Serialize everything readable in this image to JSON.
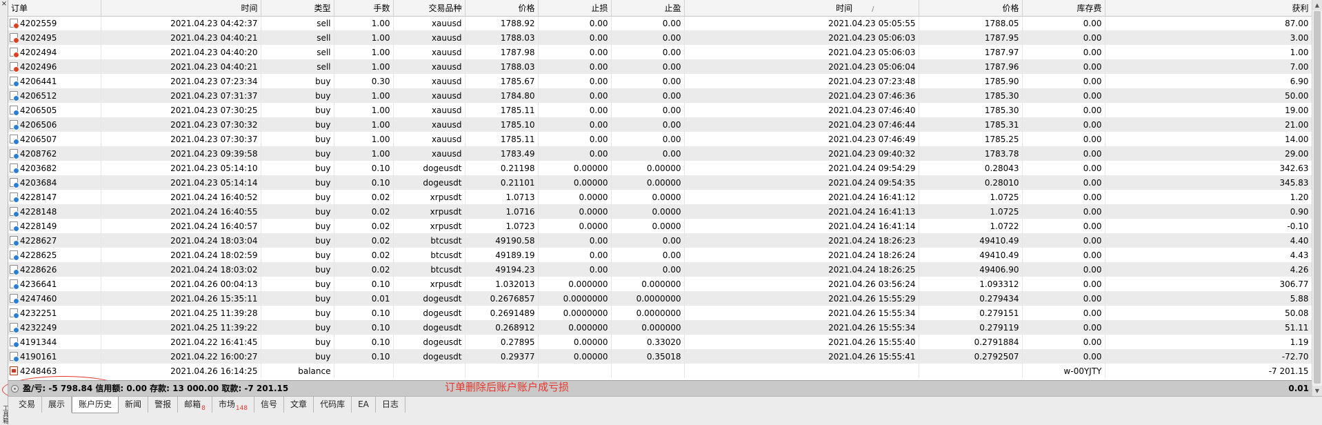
{
  "columns": [
    "订单",
    "时间",
    "类型",
    "手数",
    "交易品种",
    "价格",
    "止损",
    "止盈",
    "时间",
    "价格",
    "库存费",
    "获利"
  ],
  "sort_indicator": "/",
  "rows": [
    {
      "ticket": "4202559",
      "open_time": "2021.04.23 04:42:37",
      "type": "sell",
      "volume": "1.00",
      "symbol": "xauusd",
      "open_price": "1788.92",
      "sl": "0.00",
      "tp": "0.00",
      "close_time": "2021.04.23 05:05:55",
      "close_price": "1788.05",
      "swap": "0.00",
      "profit": "87.00",
      "icon": "sell"
    },
    {
      "ticket": "4202495",
      "open_time": "2021.04.23 04:40:21",
      "type": "sell",
      "volume": "1.00",
      "symbol": "xauusd",
      "open_price": "1788.03",
      "sl": "0.00",
      "tp": "0.00",
      "close_time": "2021.04.23 05:06:03",
      "close_price": "1787.95",
      "swap": "0.00",
      "profit": "3.00",
      "icon": "sell"
    },
    {
      "ticket": "4202494",
      "open_time": "2021.04.23 04:40:20",
      "type": "sell",
      "volume": "1.00",
      "symbol": "xauusd",
      "open_price": "1787.98",
      "sl": "0.00",
      "tp": "0.00",
      "close_time": "2021.04.23 05:06:03",
      "close_price": "1787.97",
      "swap": "0.00",
      "profit": "1.00",
      "icon": "sell"
    },
    {
      "ticket": "4202496",
      "open_time": "2021.04.23 04:40:21",
      "type": "sell",
      "volume": "1.00",
      "symbol": "xauusd",
      "open_price": "1788.03",
      "sl": "0.00",
      "tp": "0.00",
      "close_time": "2021.04.23 05:06:04",
      "close_price": "1787.96",
      "swap": "0.00",
      "profit": "7.00",
      "icon": "sell"
    },
    {
      "ticket": "4206441",
      "open_time": "2021.04.23 07:23:34",
      "type": "buy",
      "volume": "0.30",
      "symbol": "xauusd",
      "open_price": "1785.67",
      "sl": "0.00",
      "tp": "0.00",
      "close_time": "2021.04.23 07:23:48",
      "close_price": "1785.90",
      "swap": "0.00",
      "profit": "6.90",
      "icon": "buy"
    },
    {
      "ticket": "4206512",
      "open_time": "2021.04.23 07:31:37",
      "type": "buy",
      "volume": "1.00",
      "symbol": "xauusd",
      "open_price": "1784.80",
      "sl": "0.00",
      "tp": "0.00",
      "close_time": "2021.04.23 07:46:36",
      "close_price": "1785.30",
      "swap": "0.00",
      "profit": "50.00",
      "icon": "buy"
    },
    {
      "ticket": "4206505",
      "open_time": "2021.04.23 07:30:25",
      "type": "buy",
      "volume": "1.00",
      "symbol": "xauusd",
      "open_price": "1785.11",
      "sl": "0.00",
      "tp": "0.00",
      "close_time": "2021.04.23 07:46:40",
      "close_price": "1785.30",
      "swap": "0.00",
      "profit": "19.00",
      "icon": "buy"
    },
    {
      "ticket": "4206506",
      "open_time": "2021.04.23 07:30:32",
      "type": "buy",
      "volume": "1.00",
      "symbol": "xauusd",
      "open_price": "1785.10",
      "sl": "0.00",
      "tp": "0.00",
      "close_time": "2021.04.23 07:46:44",
      "close_price": "1785.31",
      "swap": "0.00",
      "profit": "21.00",
      "icon": "buy"
    },
    {
      "ticket": "4206507",
      "open_time": "2021.04.23 07:30:37",
      "type": "buy",
      "volume": "1.00",
      "symbol": "xauusd",
      "open_price": "1785.11",
      "sl": "0.00",
      "tp": "0.00",
      "close_time": "2021.04.23 07:46:49",
      "close_price": "1785.25",
      "swap": "0.00",
      "profit": "14.00",
      "icon": "buy"
    },
    {
      "ticket": "4208762",
      "open_time": "2021.04.23 09:39:58",
      "type": "buy",
      "volume": "1.00",
      "symbol": "xauusd",
      "open_price": "1783.49",
      "sl": "0.00",
      "tp": "0.00",
      "close_time": "2021.04.23 09:40:32",
      "close_price": "1783.78",
      "swap": "0.00",
      "profit": "29.00",
      "icon": "buy"
    },
    {
      "ticket": "4203682",
      "open_time": "2021.04.23 05:14:10",
      "type": "buy",
      "volume": "0.10",
      "symbol": "dogeusdt",
      "open_price": "0.21198",
      "sl": "0.00000",
      "tp": "0.00000",
      "close_time": "2021.04.24 09:54:29",
      "close_price": "0.28043",
      "swap": "0.00",
      "profit": "342.63",
      "icon": "buy"
    },
    {
      "ticket": "4203684",
      "open_time": "2021.04.23 05:14:14",
      "type": "buy",
      "volume": "0.10",
      "symbol": "dogeusdt",
      "open_price": "0.21101",
      "sl": "0.00000",
      "tp": "0.00000",
      "close_time": "2021.04.24 09:54:35",
      "close_price": "0.28010",
      "swap": "0.00",
      "profit": "345.83",
      "icon": "buy"
    },
    {
      "ticket": "4228147",
      "open_time": "2021.04.24 16:40:52",
      "type": "buy",
      "volume": "0.02",
      "symbol": "xrpusdt",
      "open_price": "1.0713",
      "sl": "0.0000",
      "tp": "0.0000",
      "close_time": "2021.04.24 16:41:12",
      "close_price": "1.0725",
      "swap": "0.00",
      "profit": "1.20",
      "icon": "buy"
    },
    {
      "ticket": "4228148",
      "open_time": "2021.04.24 16:40:55",
      "type": "buy",
      "volume": "0.02",
      "symbol": "xrpusdt",
      "open_price": "1.0716",
      "sl": "0.0000",
      "tp": "0.0000",
      "close_time": "2021.04.24 16:41:13",
      "close_price": "1.0725",
      "swap": "0.00",
      "profit": "0.90",
      "icon": "buy"
    },
    {
      "ticket": "4228149",
      "open_time": "2021.04.24 16:40:57",
      "type": "buy",
      "volume": "0.02",
      "symbol": "xrpusdt",
      "open_price": "1.0723",
      "sl": "0.0000",
      "tp": "0.0000",
      "close_time": "2021.04.24 16:41:14",
      "close_price": "1.0722",
      "swap": "0.00",
      "profit": "-0.10",
      "icon": "buy"
    },
    {
      "ticket": "4228627",
      "open_time": "2021.04.24 18:03:04",
      "type": "buy",
      "volume": "0.02",
      "symbol": "btcusdt",
      "open_price": "49190.58",
      "sl": "0.00",
      "tp": "0.00",
      "close_time": "2021.04.24 18:26:23",
      "close_price": "49410.49",
      "swap": "0.00",
      "profit": "4.40",
      "icon": "buy"
    },
    {
      "ticket": "4228625",
      "open_time": "2021.04.24 18:02:59",
      "type": "buy",
      "volume": "0.02",
      "symbol": "btcusdt",
      "open_price": "49189.19",
      "sl": "0.00",
      "tp": "0.00",
      "close_time": "2021.04.24 18:26:24",
      "close_price": "49410.49",
      "swap": "0.00",
      "profit": "4.43",
      "icon": "buy"
    },
    {
      "ticket": "4228626",
      "open_time": "2021.04.24 18:03:02",
      "type": "buy",
      "volume": "0.02",
      "symbol": "btcusdt",
      "open_price": "49194.23",
      "sl": "0.00",
      "tp": "0.00",
      "close_time": "2021.04.24 18:26:25",
      "close_price": "49406.90",
      "swap": "0.00",
      "profit": "4.26",
      "icon": "buy"
    },
    {
      "ticket": "4236641",
      "open_time": "2021.04.26 00:04:13",
      "type": "buy",
      "volume": "0.10",
      "symbol": "xrpusdt",
      "open_price": "1.032013",
      "sl": "0.000000",
      "tp": "0.000000",
      "close_time": "2021.04.26 03:56:24",
      "close_price": "1.093312",
      "swap": "0.00",
      "profit": "306.77",
      "icon": "buy"
    },
    {
      "ticket": "4247460",
      "open_time": "2021.04.26 15:35:11",
      "type": "buy",
      "volume": "0.01",
      "symbol": "dogeusdt",
      "open_price": "0.2676857",
      "sl": "0.0000000",
      "tp": "0.0000000",
      "close_time": "2021.04.26 15:55:29",
      "close_price": "0.279434",
      "swap": "0.00",
      "profit": "5.88",
      "icon": "buy"
    },
    {
      "ticket": "4232251",
      "open_time": "2021.04.25 11:39:28",
      "type": "buy",
      "volume": "0.10",
      "symbol": "dogeusdt",
      "open_price": "0.2691489",
      "sl": "0.0000000",
      "tp": "0.0000000",
      "close_time": "2021.04.26 15:55:34",
      "close_price": "0.279151",
      "swap": "0.00",
      "profit": "50.08",
      "icon": "buy"
    },
    {
      "ticket": "4232249",
      "open_time": "2021.04.25 11:39:22",
      "type": "buy",
      "volume": "0.10",
      "symbol": "dogeusdt",
      "open_price": "0.268912",
      "sl": "0.000000",
      "tp": "0.000000",
      "close_time": "2021.04.26 15:55:34",
      "close_price": "0.279119",
      "swap": "0.00",
      "profit": "51.11",
      "icon": "buy"
    },
    {
      "ticket": "4191344",
      "open_time": "2021.04.22 16:41:45",
      "type": "buy",
      "volume": "0.10",
      "symbol": "dogeusdt",
      "open_price": "0.27895",
      "sl": "0.00000",
      "tp": "0.33020",
      "close_time": "2021.04.26 15:55:40",
      "close_price": "0.2791884",
      "swap": "0.00",
      "profit": "1.19",
      "icon": "buy"
    },
    {
      "ticket": "4190161",
      "open_time": "2021.04.22 16:00:27",
      "type": "buy",
      "volume": "0.10",
      "symbol": "dogeusdt",
      "open_price": "0.29377",
      "sl": "0.00000",
      "tp": "0.35018",
      "close_time": "2021.04.26 15:55:41",
      "close_price": "0.2792507",
      "swap": "0.00",
      "profit": "-72.70",
      "icon": "buy"
    },
    {
      "ticket": "4248463",
      "open_time": "2021.04.26 16:14:25",
      "type": "balance",
      "volume": "",
      "symbol": "",
      "open_price": "",
      "sl": "",
      "tp": "",
      "close_time": "",
      "close_price": "",
      "swap": "w-00YJTY",
      "profit": "-7 201.15",
      "icon": "balance"
    }
  ],
  "summary": {
    "text": "盈/亏: -5 798.84  信用额: 0.00  存款: 13 000.00  取款: -7 201.15",
    "total": "0.01"
  },
  "annotation": "订单删除后账户账户成亏损",
  "tabs": [
    {
      "label": "交易",
      "badge": ""
    },
    {
      "label": "展示",
      "badge": ""
    },
    {
      "label": "账户历史",
      "badge": "",
      "active": true
    },
    {
      "label": "新闻",
      "badge": ""
    },
    {
      "label": "警报",
      "badge": ""
    },
    {
      "label": "邮箱",
      "badge": "8"
    },
    {
      "label": "市场",
      "badge": "148"
    },
    {
      "label": "信号",
      "badge": ""
    },
    {
      "label": "文章",
      "badge": ""
    },
    {
      "label": "代码库",
      "badge": ""
    },
    {
      "label": "EA",
      "badge": ""
    },
    {
      "label": "日志",
      "badge": ""
    }
  ],
  "side_label": "工具箱",
  "colors": {
    "annotation": "#e8352a",
    "sell_icon": "#d9431f",
    "buy_icon": "#2a7fd4"
  }
}
